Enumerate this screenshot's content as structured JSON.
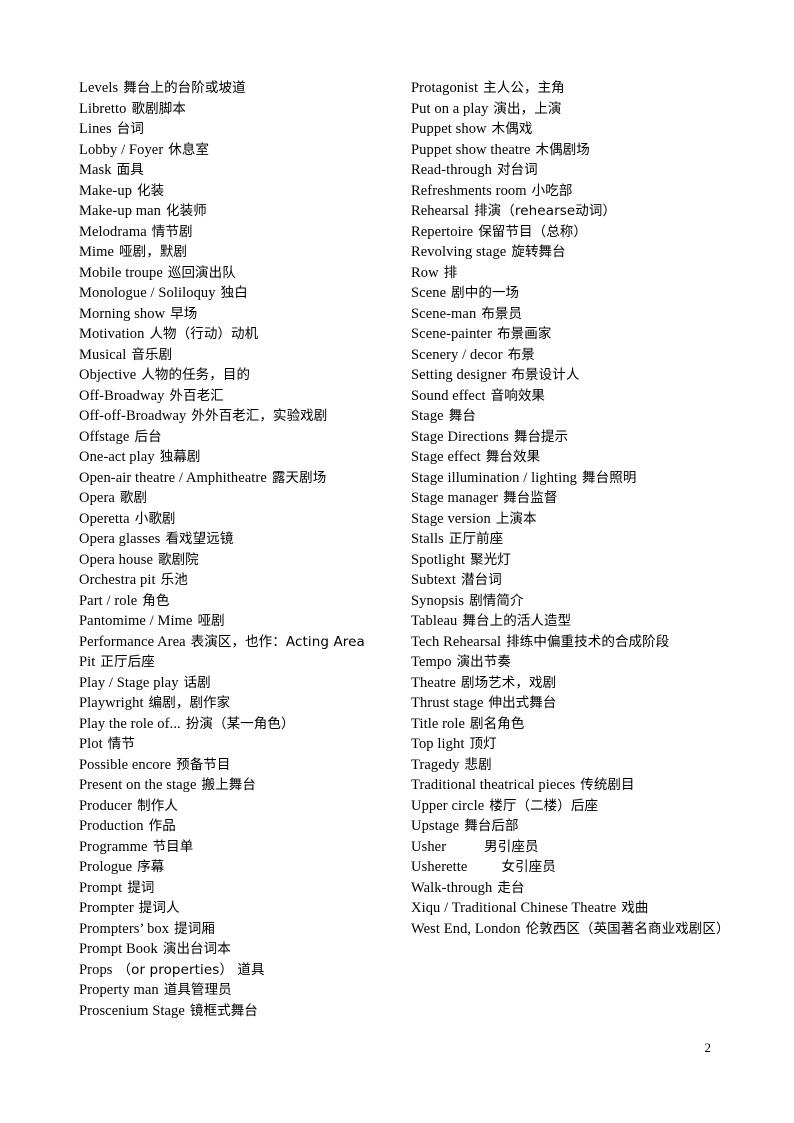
{
  "document": {
    "page_number": "2",
    "text_color": "#000000",
    "background_color": "#ffffff"
  },
  "left_column": [
    {
      "term": "Levels",
      "gloss": "舞台上的台阶或坡道"
    },
    {
      "term": "Libretto",
      "gloss": "歌剧脚本"
    },
    {
      "term": "Lines",
      "gloss": "台词"
    },
    {
      "term": "Lobby / Foyer",
      "gloss": "休息室"
    },
    {
      "term": "Mask",
      "gloss": "面具"
    },
    {
      "term": "Make-up",
      "gloss": "化装"
    },
    {
      "term": "Make-up man",
      "gloss": "化装师"
    },
    {
      "term": "Melodrama",
      "gloss": "情节剧"
    },
    {
      "term": "Mime",
      "gloss": "哑剧，默剧"
    },
    {
      "term": "Mobile troupe",
      "gloss": "巡回演出队"
    },
    {
      "term": "Monologue / Soliloquy",
      "gloss": "独白"
    },
    {
      "term": "Morning show",
      "gloss": "早场"
    },
    {
      "term": "Motivation",
      "gloss": "人物（行动）动机"
    },
    {
      "term": "Musical",
      "gloss": "音乐剧"
    },
    {
      "term": "Objective",
      "gloss": "人物的任务，目的"
    },
    {
      "term": "Off-Broadway",
      "gloss": "外百老汇"
    },
    {
      "term": "Off-off-Broadway",
      "gloss": "外外百老汇，实验戏剧"
    },
    {
      "term": "Offstage",
      "gloss": "后台"
    },
    {
      "term": "One-act play",
      "gloss": "独幕剧"
    },
    {
      "term": "Open-air theatre / Amphitheatre",
      "gloss": "露天剧场"
    },
    {
      "term": "Opera",
      "gloss": "歌剧"
    },
    {
      "term": "Operetta",
      "gloss": "小歌剧"
    },
    {
      "term": "Opera glasses",
      "gloss": "看戏望远镜"
    },
    {
      "term": "Opera house",
      "gloss": "歌剧院"
    },
    {
      "term": "Orchestra pit",
      "gloss": "乐池"
    },
    {
      "term": "Part / role",
      "gloss": "角色"
    },
    {
      "term": "Pantomime / Mime",
      "gloss": "哑剧"
    },
    {
      "term": "Performance Area",
      "gloss": "表演区，也作：Acting Area"
    },
    {
      "term": "Pit",
      "gloss": "正厅后座"
    },
    {
      "term": "Play / Stage play",
      "gloss": "话剧"
    },
    {
      "term": "Playwright",
      "gloss": "编剧，剧作家"
    },
    {
      "term": "Play the role of...",
      "gloss": "扮演（某一角色）"
    },
    {
      "term": "Plot",
      "gloss": "情节"
    },
    {
      "term": "Possible encore",
      "gloss": "预备节目"
    },
    {
      "term": "Present on the stage",
      "gloss": "搬上舞台"
    },
    {
      "term": "Producer",
      "gloss": "制作人"
    },
    {
      "term": "Production",
      "gloss": "作品"
    },
    {
      "term": "Programme",
      "gloss": "节目单"
    },
    {
      "term": "Prologue",
      "gloss": "序幕"
    },
    {
      "term": "Prompt",
      "gloss": "提词"
    },
    {
      "term": "Prompter",
      "gloss": "提词人"
    },
    {
      "term": "Prompters’ box",
      "gloss": "提词厢"
    },
    {
      "term": "Prompt Book",
      "gloss": "演出台词本"
    },
    {
      "term": "Props",
      "gloss": "（or properties） 道具"
    },
    {
      "term": "Property man",
      "gloss": "道具管理员"
    },
    {
      "term": "Proscenium Stage",
      "gloss": "镜框式舞台"
    }
  ],
  "right_column": [
    {
      "term": "Protagonist",
      "gloss": "主人公，主角"
    },
    {
      "term": "Put on a play",
      "gloss": "演出，上演"
    },
    {
      "term": "Puppet show",
      "gloss": "木偶戏"
    },
    {
      "term": "Puppet show theatre",
      "gloss": "木偶剧场"
    },
    {
      "term": "Read-through",
      "gloss": "对台词"
    },
    {
      "term": "Refreshments room",
      "gloss": "小吃部"
    },
    {
      "term": "Rehearsal",
      "gloss": "排演（rehearse动词）"
    },
    {
      "term": "Repertoire",
      "gloss": "保留节目（总称）"
    },
    {
      "term": "Revolving stage",
      "gloss": "旋转舞台"
    },
    {
      "term": "Row",
      "gloss": "排"
    },
    {
      "term": "Scene",
      "gloss": "剧中的一场"
    },
    {
      "term": "Scene-man",
      "gloss": "布景员"
    },
    {
      "term": "Scene-painter",
      "gloss": "布景画家"
    },
    {
      "term": "Scenery / decor",
      "gloss": "布景"
    },
    {
      "term": "Setting designer",
      "gloss": "布景设计人"
    },
    {
      "term": "Sound effect",
      "gloss": "音响效果"
    },
    {
      "term": "Stage",
      "gloss": "舞台"
    },
    {
      "term": "Stage Directions",
      "gloss": "舞台提示"
    },
    {
      "term": "Stage effect",
      "gloss": "舞台效果"
    },
    {
      "term": "Stage illumination / lighting",
      "gloss": "舞台照明"
    },
    {
      "term": "Stage manager",
      "gloss": "舞台监督"
    },
    {
      "term": "Stage version",
      "gloss": "上演本"
    },
    {
      "term": "Stalls",
      "gloss": "正厅前座"
    },
    {
      "term": "Spotlight",
      "gloss": "聚光灯"
    },
    {
      "term": "Subtext",
      "gloss": "潜台词"
    },
    {
      "term": "Synopsis",
      "gloss": "剧情简介"
    },
    {
      "term": "Tableau",
      "gloss": "舞台上的活人造型"
    },
    {
      "term": "Tech Rehearsal",
      "gloss": "排练中偏重技术的合成阶段"
    },
    {
      "term": "Tempo",
      "gloss": "演出节奏"
    },
    {
      "term": "Theatre",
      "gloss": "剧场艺术，戏剧"
    },
    {
      "term": "Thrust stage",
      "gloss": "伸出式舞台"
    },
    {
      "term": "Title role",
      "gloss": "剧名角色"
    },
    {
      "term": "Top light",
      "gloss": "顶灯"
    },
    {
      "term": "Tragedy",
      "gloss": "悲剧"
    },
    {
      "term": "Traditional theatrical pieces",
      "gloss": "传统剧目"
    },
    {
      "term": "Upper circle",
      "gloss": "楼厅（二楼）后座"
    },
    {
      "term": "Upstage",
      "gloss": "舞台后部"
    },
    {
      "term": "Usher",
      "gloss": "男引座员",
      "gap": "wide"
    },
    {
      "term": "Usherette",
      "gloss": "女引座员",
      "gap": "xwide"
    },
    {
      "term": "Walk-through",
      "gloss": "走台"
    },
    {
      "term": "Xiqu / Traditional Chinese Theatre",
      "gloss": "戏曲"
    },
    {
      "term": "West End, London",
      "gloss": "伦敦西区（英国著名商业戏剧区）",
      "wrap": true
    }
  ]
}
